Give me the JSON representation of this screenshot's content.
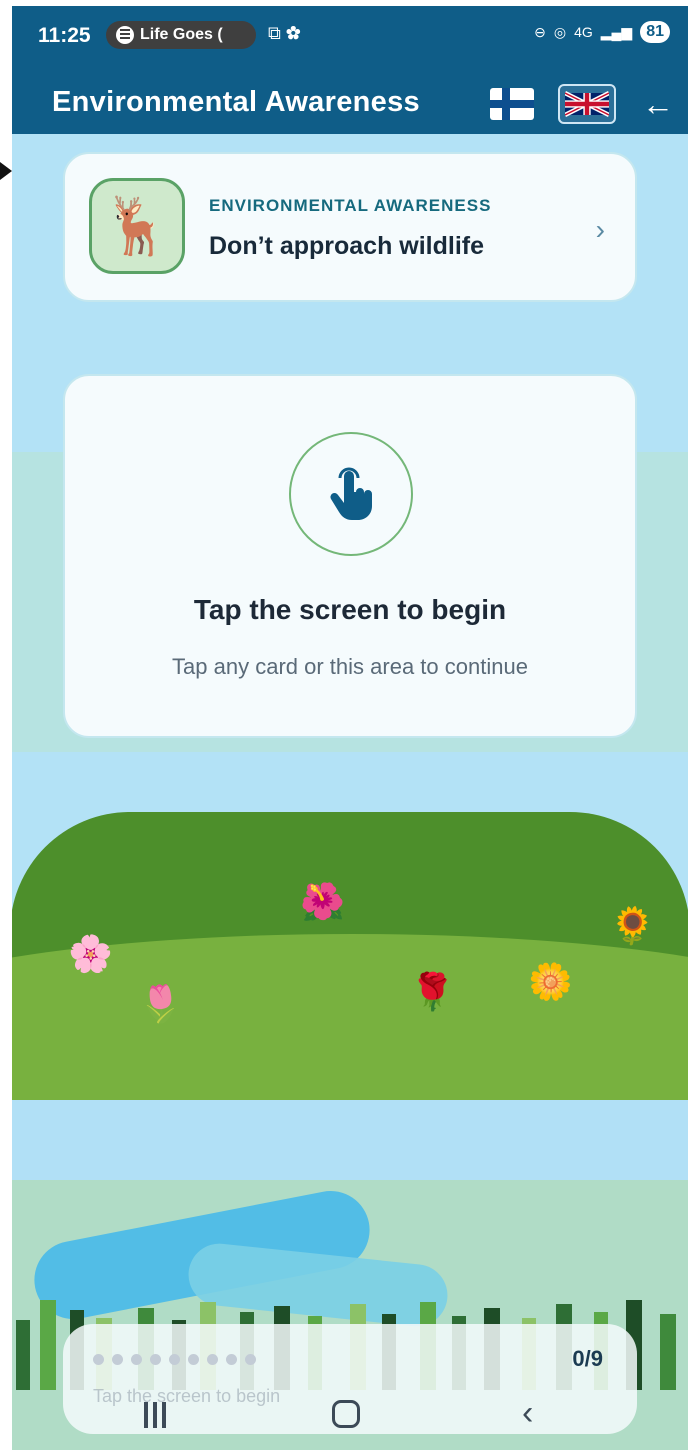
{
  "status_bar": {
    "time": "11:25",
    "media_label": "Life Goes (",
    "network": "4G",
    "battery": "81"
  },
  "header": {
    "title": "Environmental Awareness",
    "lang_fi": "Finnish",
    "lang_en": "English",
    "back_icon": "arrow-left-icon"
  },
  "lesson_card": {
    "category": "ENVIRONMENTAL AWARENESS",
    "title": "Don’t approach wildlife",
    "emoji": "🦌"
  },
  "tap_card": {
    "heading": "Tap the screen to begin",
    "subtext": "Tap any card or this area to continue"
  },
  "scenery": {
    "flowers": [
      "🌸",
      "🌷",
      "🌺",
      "🌹",
      "🌼",
      "🌻"
    ]
  },
  "progress": {
    "count": "0/9",
    "current": 0,
    "total": 9,
    "hint": "Tap the screen to begin"
  },
  "colors": {
    "header": "#0f5d88",
    "sky": "#b3e2f6",
    "hill_dark": "#4d8f2b",
    "hill_light": "#78b13f",
    "accent_green": "#74b778"
  }
}
